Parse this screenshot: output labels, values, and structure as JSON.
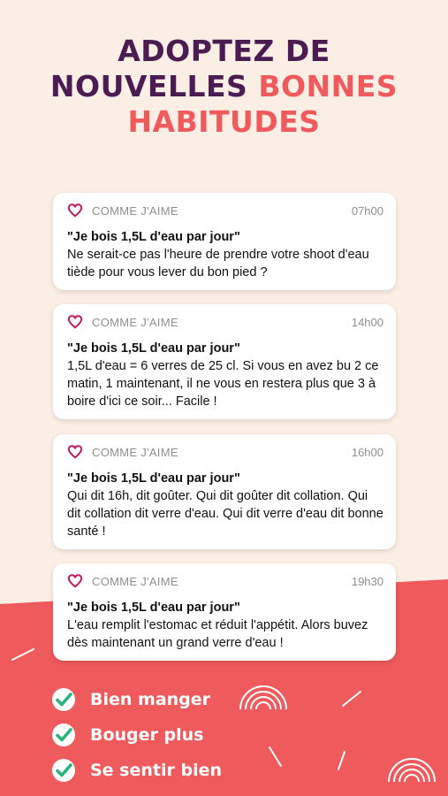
{
  "headline": {
    "line1": "ADOPTEZ DE",
    "line2_dark": "NOUVELLES ",
    "line2_accent": "BONNES",
    "line3_accent": "HABITUDES"
  },
  "notifications": [
    {
      "app": "COMME J'AIME",
      "time": "07h00",
      "title": "\"Je bois 1,5L d'eau par jour\"",
      "body": "Ne serait-ce pas l'heure de prendre votre shoot d'eau tiède pour vous lever du bon pied ?"
    },
    {
      "app": "COMME J'AIME",
      "time": "14h00",
      "title": "\"Je bois 1,5L d'eau par jour\"",
      "body": "1,5L d'eau = 6 verres de 25 cl. Si vous en avez bu 2 ce matin, 1 maintenant, il ne vous en restera plus que 3 à boire d'ici ce soir... Facile !"
    },
    {
      "app": "COMME J'AIME",
      "time": "16h00",
      "title": "\"Je bois 1,5L d'eau par jour\"",
      "body": "Qui dit 16h, dit goûter. Qui dit goûter dit collation. Qui dit collation dit verre d'eau. Qui dit verre d'eau dit bonne santé !"
    },
    {
      "app": "COMME J'AIME",
      "time": "19h30",
      "title": "\"Je bois 1,5L d'eau par jour\"",
      "body": "L'eau remplit l'estomac et réduit l'appétit. Alors buvez dès maintenant un grand verre d'eau !"
    }
  ],
  "checklist": [
    {
      "label": "Bien manger",
      "icon": "check-circle-icon"
    },
    {
      "label": "Bouger plus",
      "icon": "check-circle-icon"
    },
    {
      "label": "Se sentir bien",
      "icon": "check-circle-icon"
    }
  ],
  "colors": {
    "background": "#fbeee5",
    "headline_dark": "#4a1c52",
    "accent_coral": "#ef5a5d",
    "check_green": "#28b37a",
    "brand_icon": "#c2185b"
  }
}
